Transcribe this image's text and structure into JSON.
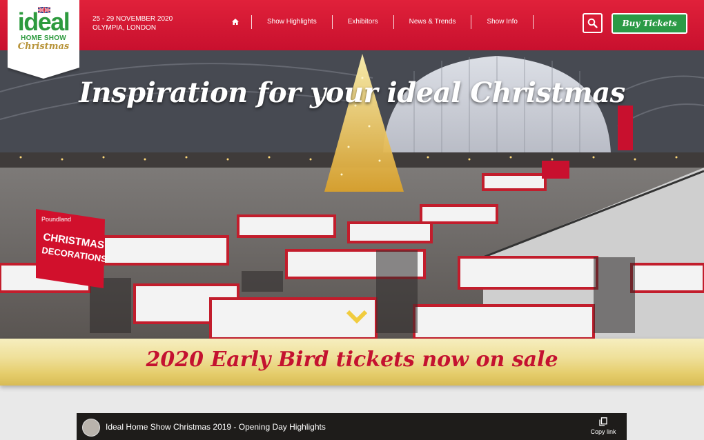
{
  "brand": {
    "line1": "ideal",
    "line2": "HOME SHOW",
    "line3": "Christmas"
  },
  "event": {
    "dates": "25 - 29 NOVEMBER 2020",
    "venue": "OLYMPIA, LONDON"
  },
  "nav": {
    "items": [
      "Show Highlights",
      "Exhibitors",
      "News & Trends",
      "Show Info"
    ]
  },
  "header": {
    "buy_label": "Buy Tickets"
  },
  "hero": {
    "title": "Inspiration for your ideal Christmas",
    "sign_text": "CHRISTMAS DECORATIONS",
    "sign_brand": "Poundland"
  },
  "banner": {
    "text": "2020 Early Bird tickets now on sale"
  },
  "video": {
    "title": "Ideal Home Show Christmas 2019 - Opening Day Highlights",
    "copy_label": "Copy link"
  },
  "colors": {
    "header_red": "#c8102e",
    "brand_green": "#2d9a3e",
    "buy_green": "#2b9a46",
    "banner_gold": "#efe09a",
    "banner_text_red": "#c41230"
  }
}
